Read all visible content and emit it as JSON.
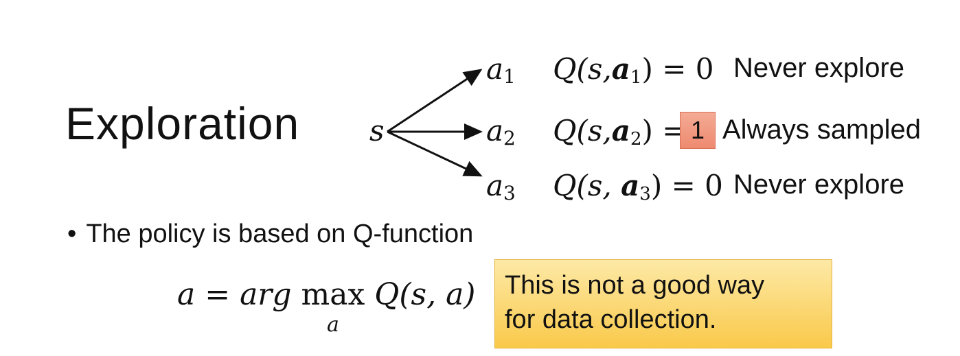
{
  "slide": {
    "title": "Exploration",
    "state_symbol": "s",
    "actions": [
      {
        "symbol": "a",
        "index": "1",
        "q_prefix": "Q(s,",
        "q_action": "a",
        "q_index": "1",
        "q_suffix": ") = ",
        "q_value": "0",
        "note": "Never explore"
      },
      {
        "symbol": "a",
        "index": "2",
        "q_prefix": "Q(s,",
        "q_action": "a",
        "q_index": "2",
        "q_suffix": ") = ",
        "q_value": "1",
        "note": "Always sampled"
      },
      {
        "symbol": "a",
        "index": "3",
        "q_prefix": "Q(s, ",
        "q_action": "a",
        "q_index": "3",
        "q_suffix": ") = ",
        "q_value": "0",
        "note": "Never explore"
      }
    ],
    "bullet": "The policy is based on Q-function",
    "policy_formula": {
      "lhs": "a = arg ",
      "op": "max",
      "op_sub": "a",
      "rhs": "Q(s, a)"
    },
    "callout": {
      "line1": "This is not a good way",
      "line2": "for data collection."
    },
    "colors": {
      "highlight": "#ee8a70",
      "callout": "#f9c94a"
    }
  }
}
